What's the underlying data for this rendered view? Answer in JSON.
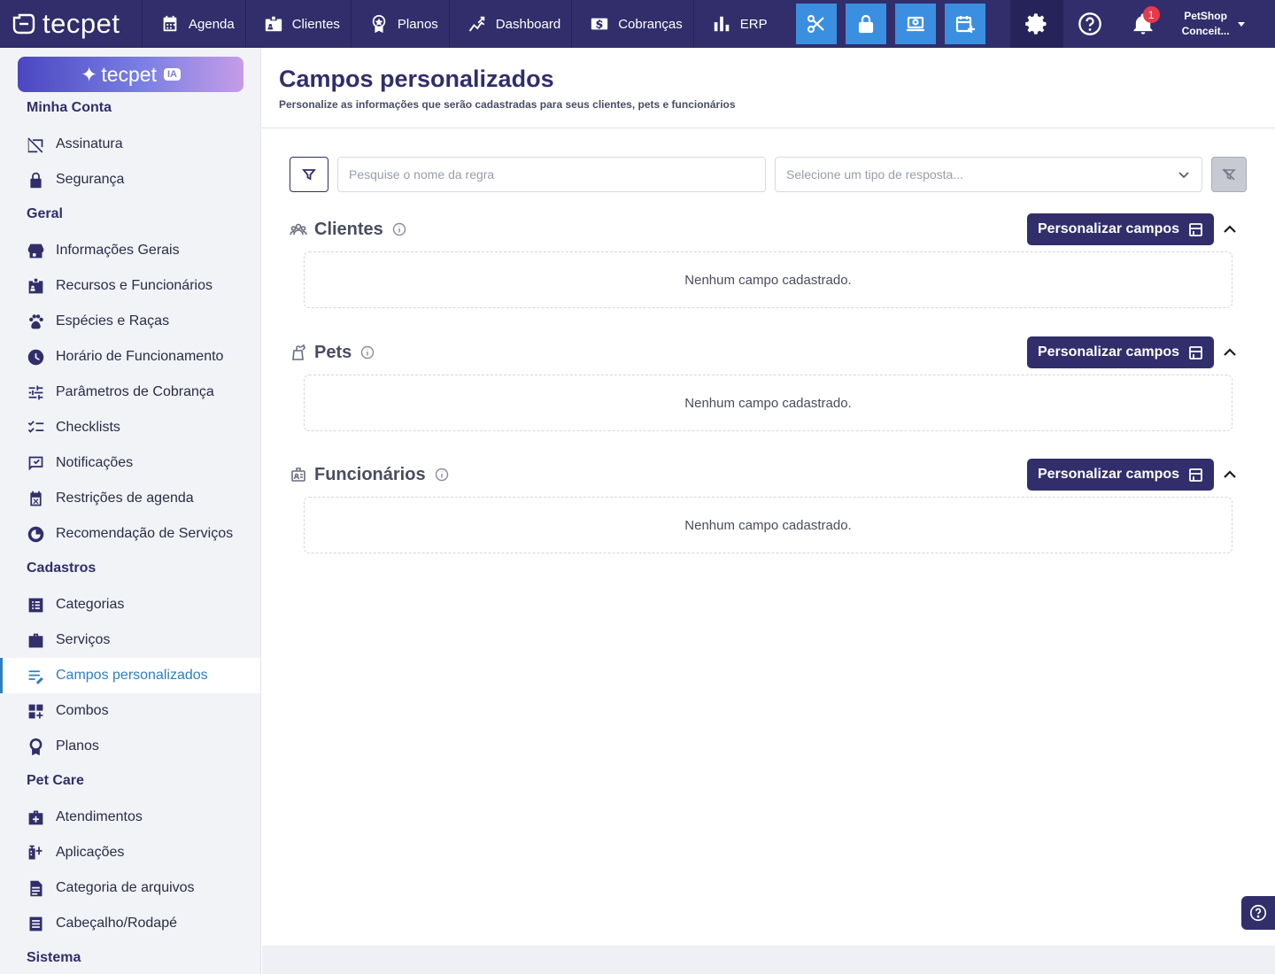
{
  "brand": {
    "name": "tecpet"
  },
  "nav": [
    {
      "label": "Agenda",
      "icon": "calendar-icon"
    },
    {
      "label": "Clientes",
      "icon": "id-card-icon"
    },
    {
      "label": "Planos",
      "icon": "award-icon"
    },
    {
      "label": "Dashboard",
      "icon": "chart-line-icon"
    },
    {
      "label": "Cobranças",
      "icon": "dollar-icon"
    },
    {
      "label": "ERP",
      "icon": "bar-chart-icon"
    }
  ],
  "notifications": {
    "count": "1"
  },
  "user": {
    "line1": "PetShop",
    "line2": "Conceit..."
  },
  "sidebar": {
    "ia": {
      "brand": "tecpet",
      "tag": "IA"
    },
    "sections": [
      {
        "title": "Minha Conta",
        "items": [
          "Assinatura",
          "Segurança"
        ]
      },
      {
        "title": "Geral",
        "items": [
          "Informações Gerais",
          "Recursos e Funcionários",
          "Espécies e Raças",
          "Horário de Funcionamento",
          "Parâmetros de Cobrança",
          "Checklists",
          "Notificações",
          "Restrições de agenda",
          "Recomendação de Serviços"
        ]
      },
      {
        "title": "Cadastros",
        "items": [
          "Categorias",
          "Serviços",
          "Campos personalizados",
          "Combos",
          "Planos"
        ]
      },
      {
        "title": "Pet Care",
        "items": [
          "Atendimentos",
          "Aplicações",
          "Categoria de arquivos",
          "Cabeçalho/Rodapé"
        ]
      },
      {
        "title": "Sistema",
        "items": []
      }
    ],
    "active": "Campos personalizados"
  },
  "page": {
    "title": "Campos personalizados",
    "subtitle": "Personalize as informações que serão cadastradas para seus clientes, pets e funcionários"
  },
  "filters": {
    "search_placeholder": "Pesquise o nome da regra",
    "select_placeholder": "Selecione um tipo de resposta..."
  },
  "sections": [
    {
      "name": "Clientes",
      "button": "Personalizar campos",
      "empty": "Nenhum campo cadastrado."
    },
    {
      "name": "Pets",
      "button": "Personalizar campos",
      "empty": "Nenhum campo cadastrado."
    },
    {
      "name": "Funcionários",
      "button": "Personalizar campos",
      "empty": "Nenhum campo cadastrado."
    }
  ],
  "colors": {
    "primary": "#312e6b",
    "accent": "#3a8fe0",
    "active": "#2f7fc0"
  }
}
